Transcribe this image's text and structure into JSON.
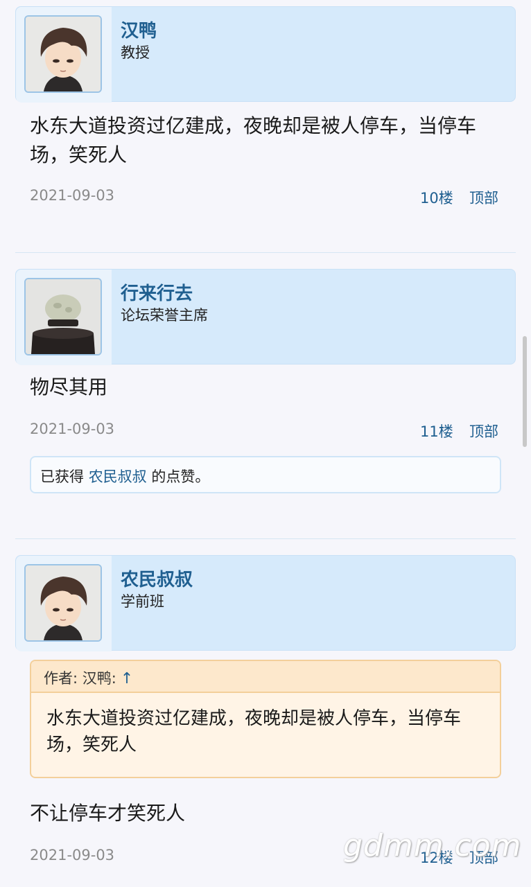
{
  "posts": [
    {
      "user": "汉鸭",
      "rank": "教授",
      "avatar_icon": "cartoon-boy-avatar-icon",
      "content": "水东大道投资过亿建成，夜晚却是被人停车，当停车场，笑死人",
      "date": "2021-09-03",
      "floor": "10楼",
      "top_label": "顶部"
    },
    {
      "user": "行来行去",
      "rank": "论坛荣誉主席",
      "avatar_icon": "jade-ornament-avatar-icon",
      "content": "物尽其用",
      "date": "2021-09-03",
      "floor": "11楼",
      "top_label": "顶部",
      "like": {
        "prefix": "已获得",
        "user": "农民叔叔",
        "suffix": "的点赞。"
      }
    },
    {
      "user": "农民叔叔",
      "rank": "学前班",
      "avatar_icon": "cartoon-boy-avatar-icon",
      "quote": {
        "author_label": "作者: 汉鸭:",
        "arrow": "↑",
        "text": "水东大道投资过亿建成，夜晚却是被人停车，当停车场，笑死人"
      },
      "content": "不让停车才笑死人",
      "date": "2021-09-03",
      "floor": "12楼",
      "top_label": "顶部"
    }
  ],
  "watermark": "gdmm.com",
  "colors": {
    "link": "#1f5f90",
    "header_bg": "#d6eafb",
    "quote_bg": "#fff4e6"
  }
}
